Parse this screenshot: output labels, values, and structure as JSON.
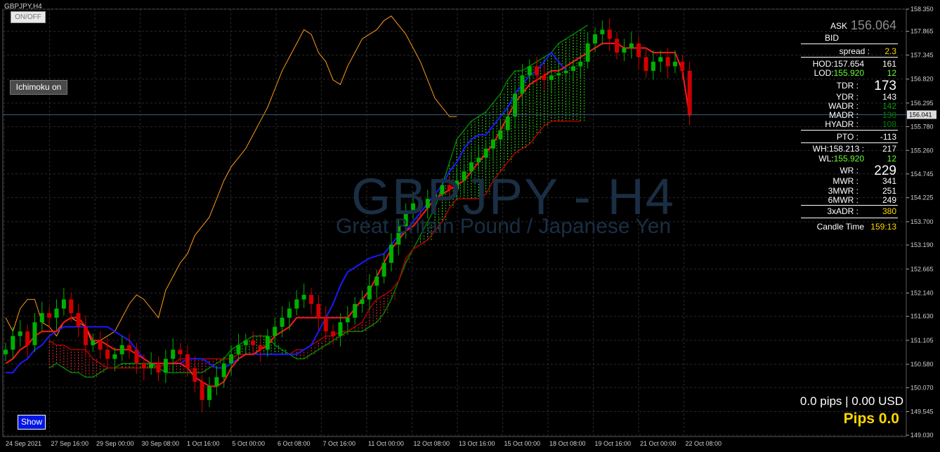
{
  "window": {
    "symbol_label": "GBPJPY,H4",
    "onoff_label": "ON/OFF",
    "ichimoku_button": "Ichimoku on",
    "show_button": "Show"
  },
  "watermark": {
    "title": "GBPJPY - H4",
    "subtitle": "Great Britain Pound / Japanese Yen"
  },
  "price_axis": {
    "current_price": "156.041"
  },
  "info_panel": {
    "ask_label": "ASK",
    "ask_value": "156.064",
    "bid_label": "BID",
    "spread_label": "spread :",
    "spread_value": "2.3",
    "hod_label": "HOD:157.654",
    "hod_value": "161",
    "lod_label_prefix": "LOD:",
    "lod_label_price": "155.920",
    "lod_value": "12",
    "tdr_label": "TDR :",
    "tdr_value": "173",
    "ydr_label": "YDR :",
    "ydr_value": "143",
    "wadr_label": "WADR :",
    "wadr_value": "142",
    "madr_label": "MADR :",
    "madr_value": "130",
    "hyadr_label": "HYADR :",
    "hyadr_value": "108",
    "pto_label": "PTO :",
    "pto_value": "-113",
    "wh_label": "WH:158.213 :",
    "wh_value": "217",
    "wl_label_prefix": "WL:",
    "wl_label_price": "155.920",
    "wl_value": "12",
    "wr_label": "WR :",
    "wr_value": "229",
    "mwr_label": "MWR :",
    "mwr_value": "341",
    "mwr3_label": "3MWR :",
    "mwr3_value": "251",
    "mwr6_label": "6MWR :",
    "mwr6_value": "249",
    "xadr_label": "3xADR :",
    "xadr_value": "380",
    "candle_label": "Candle Time",
    "candle_value": "159:13"
  },
  "pips": {
    "line": "0.0 pips | 0.00 USD",
    "big": "Pips 0.0"
  },
  "colors": {
    "bull": "#00b000",
    "bear": "#d00000",
    "tenkan": "#ff1a1a",
    "kijun": "#1a1aff",
    "chikou": "#ff9a1a",
    "span_a": "#008000",
    "span_b": "#b00000",
    "yellow": "#ffd700",
    "green_text": "#66ff33",
    "grid": "#2a2a2a"
  },
  "chart_data": {
    "type": "candlestick",
    "title": "GBPJPY,H4",
    "ylim": [
      149.0,
      158.35
    ],
    "y_ticks": [
      "158.350",
      "157.865",
      "157.345",
      "156.820",
      "156.295",
      "155.780",
      "155.260",
      "154.745",
      "154.225",
      "153.700",
      "153.190",
      "152.665",
      "152.140",
      "151.630",
      "151.105",
      "150.580",
      "150.070",
      "149.545",
      "149.030"
    ],
    "x_ticks": [
      "24 Sep 2021",
      "27 Sep 16:00",
      "29 Sep 00:00",
      "30 Sep 08:00",
      "1 Oct 16:00",
      "5 Oct 00:00",
      "6 Oct 08:00",
      "7 Oct 16:00",
      "11 Oct 00:00",
      "12 Oct 08:00",
      "13 Oct 16:00",
      "15 Oct 00:00",
      "18 Oct 08:00",
      "19 Oct 16:00",
      "21 Oct 00:00",
      "22 Oct 08:00"
    ],
    "closes": [
      150.9,
      151.2,
      151.3,
      151.0,
      151.5,
      151.7,
      151.6,
      151.8,
      152.0,
      151.7,
      151.4,
      151.0,
      151.1,
      150.9,
      150.7,
      150.8,
      151.0,
      150.9,
      150.6,
      150.5,
      150.6,
      150.4,
      150.7,
      150.9,
      150.8,
      150.5,
      150.2,
      149.8,
      150.1,
      150.3,
      150.6,
      150.8,
      151.0,
      151.1,
      151.0,
      150.9,
      151.2,
      151.4,
      151.6,
      151.8,
      152.0,
      152.1,
      151.9,
      151.6,
      151.3,
      151.2,
      151.5,
      151.6,
      151.9,
      152.0,
      152.3,
      152.5,
      152.8,
      153.2,
      153.6,
      153.9,
      154.1,
      154.0,
      154.2,
      154.3,
      154.5,
      154.4,
      154.6,
      154.8,
      155.0,
      155.1,
      155.3,
      155.5,
      155.7,
      156.0,
      156.5,
      156.9,
      157.1,
      156.9,
      156.8,
      156.9,
      156.95,
      157.0,
      157.1,
      157.2,
      157.6,
      157.8,
      157.9,
      157.7,
      157.4,
      157.5,
      157.6,
      157.3,
      157.0,
      157.2,
      157.3,
      157.1,
      157.2,
      157.0,
      156.041
    ],
    "tenkan": [
      150.6,
      150.7,
      150.9,
      151.0,
      151.2,
      151.3,
      151.3,
      151.3,
      151.5,
      151.6,
      151.6,
      151.4,
      151.1,
      151.1,
      151.0,
      150.9,
      150.9,
      150.9,
      150.8,
      150.7,
      150.6,
      150.6,
      150.6,
      150.6,
      150.6,
      150.5,
      150.3,
      150.2,
      150.1,
      150.1,
      150.2,
      150.5,
      150.7,
      150.8,
      150.8,
      150.9,
      151.0,
      151.2,
      151.3,
      151.4,
      151.6,
      151.6,
      151.6,
      151.6,
      151.6,
      151.6,
      151.6,
      151.6,
      151.8,
      152.0,
      152.2,
      152.5,
      152.8,
      153.1,
      153.3,
      153.5,
      153.6,
      153.8,
      154.0,
      154.2,
      154.3,
      154.4,
      154.5,
      154.6,
      154.8,
      155.0,
      155.2,
      155.4,
      155.7,
      156.0,
      156.3,
      156.5,
      156.7,
      156.8,
      156.9,
      157.0,
      157.0,
      157.1,
      157.2,
      157.3,
      157.4,
      157.5,
      157.6,
      157.6,
      157.6,
      157.5,
      157.5,
      157.5,
      157.5,
      157.4,
      157.4,
      157.4,
      157.4,
      157.0,
      156.0
    ],
    "kijun": [
      150.4,
      150.4,
      150.6,
      150.7,
      150.9,
      151.0,
      151.2,
      151.3,
      151.4,
      151.4,
      151.4,
      151.4,
      151.4,
      151.4,
      151.4,
      151.3,
      151.2,
      151.1,
      150.9,
      150.7,
      150.6,
      150.6,
      150.6,
      150.6,
      150.6,
      150.7,
      150.7,
      150.7,
      150.6,
      150.5,
      150.5,
      150.6,
      150.7,
      150.8,
      150.8,
      150.8,
      150.8,
      150.8,
      150.8,
      150.8,
      150.8,
      150.9,
      151.0,
      151.3,
      151.6,
      151.9,
      152.3,
      152.6,
      152.7,
      152.8,
      152.9,
      152.95,
      153.0,
      153.2,
      153.4,
      153.5,
      153.7,
      153.9,
      154.1,
      154.3,
      154.5,
      154.8,
      155.0,
      155.3,
      155.5,
      155.6,
      155.6,
      155.8,
      156.0,
      156.2,
      156.5,
      156.7,
      156.9,
      157.0,
      157.2,
      157.4,
      157.2,
      157.0
    ],
    "chikou": [
      151.6,
      151.3,
      151.8,
      152.0,
      152.0,
      151.5,
      151.4,
      151.2,
      151.5,
      151.6,
      151.5,
      151.4,
      151.0,
      151.1,
      151.2,
      151.3,
      151.6,
      151.9,
      152.1,
      152.0,
      151.8,
      151.6,
      152.2,
      152.5,
      152.8,
      153.0,
      153.4,
      153.6,
      153.8,
      154.2,
      154.6,
      154.9,
      155.1,
      155.3,
      155.6,
      155.9,
      156.2,
      156.6,
      157.0,
      157.3,
      157.6,
      157.9,
      157.8,
      157.4,
      157.2,
      156.8,
      156.7,
      157.1,
      157.4,
      157.7,
      157.8,
      157.9,
      158.1,
      158.2,
      158.0,
      157.8,
      157.5,
      157.2,
      156.8,
      156.4,
      156.2,
      156.0,
      156.0
    ],
    "span_a": [
      150.5,
      150.6,
      150.5,
      150.4,
      150.4,
      150.3,
      150.3,
      150.4,
      150.5,
      150.5,
      150.6,
      150.6,
      150.6,
      150.6,
      150.6,
      150.5,
      150.4,
      150.4,
      150.4,
      150.4,
      150.4,
      150.4,
      150.5,
      150.6,
      150.7,
      150.9,
      151.0,
      151.1,
      151.2,
      151.2,
      151.2,
      151.0,
      150.9,
      150.8,
      150.7,
      150.7,
      150.8,
      150.9,
      151.0,
      151.1,
      151.2,
      151.3,
      151.3,
      151.3,
      151.4,
      151.5,
      151.7,
      152.0,
      152.4,
      152.8,
      153.1,
      153.4,
      153.7,
      154.0,
      154.5,
      155.0,
      155.5,
      155.7,
      155.9,
      156.0,
      156.1,
      156.3,
      156.5,
      156.8,
      157.0,
      157.0,
      157.1,
      157.2,
      157.3,
      157.4,
      157.6,
      157.7,
      157.8,
      157.9,
      158.0
    ],
    "span_b": [
      151.1,
      151.0,
      151.0,
      150.9,
      150.9,
      150.9,
      150.7,
      150.6,
      150.5,
      150.5,
      150.5,
      150.5,
      150.5,
      150.5,
      150.5,
      150.5,
      150.6,
      150.6,
      150.7,
      150.7,
      150.7,
      150.7,
      150.7,
      150.7,
      150.7,
      150.7,
      150.8,
      150.8,
      150.8,
      150.8,
      150.8,
      150.8,
      150.8,
      150.8,
      150.9,
      150.9,
      151.0,
      151.1,
      151.2,
      151.2,
      151.3,
      151.3,
      151.4,
      151.5,
      151.8,
      152.0,
      152.1,
      152.2,
      152.4,
      152.9,
      153.1,
      153.2,
      153.3,
      153.5,
      153.7,
      154.0,
      154.2,
      154.2,
      154.2,
      154.2,
      154.3,
      154.6,
      154.8,
      155.0,
      155.2,
      155.3,
      155.4,
      155.6,
      155.8,
      155.9,
      155.9,
      155.9,
      155.9,
      155.9
    ]
  }
}
